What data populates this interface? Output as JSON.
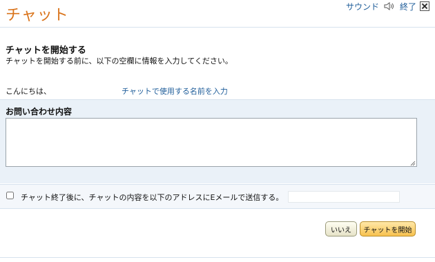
{
  "header": {
    "title": "チャット",
    "sound_label": "サウンド",
    "end_label": "終了",
    "speaker_icon": "speaker-icon",
    "close_icon": "close-icon"
  },
  "intro": {
    "heading": "チャットを開始する",
    "description": "チャットを開始する前に、以下の空欄に情報を入力してください。"
  },
  "greeting": {
    "text": "こんにちは、",
    "name_link": "チャットで使用する名前を入力"
  },
  "inquiry": {
    "label": "お問い合わせ内容",
    "value": ""
  },
  "email": {
    "checked": false,
    "label": "チャット終了後に、チャットの内容を以下のアドレスにEメールで送信する。",
    "value": ""
  },
  "buttons": {
    "no_label": "いいえ",
    "start_label": "チャットを開始"
  },
  "colors": {
    "title": "#d9731a",
    "link": "#1d5c99",
    "panel": "#eaf1f8",
    "start_button": "#f7c14f"
  }
}
